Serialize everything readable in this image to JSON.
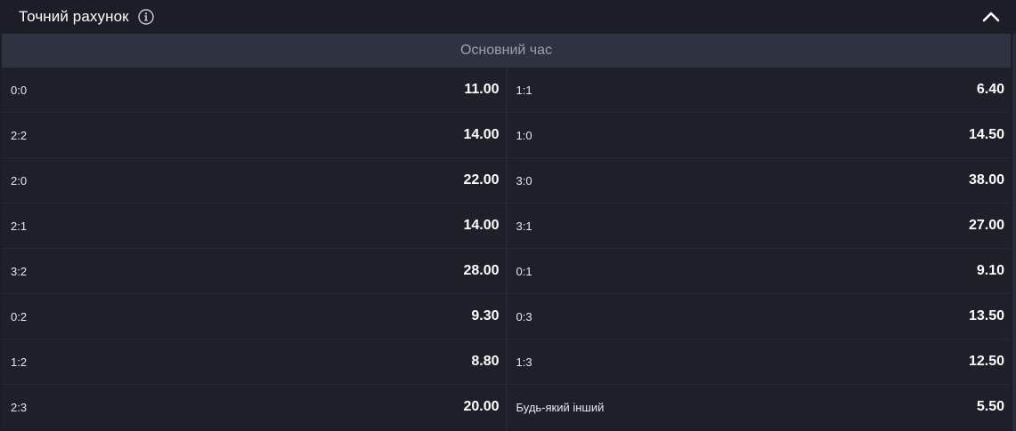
{
  "header": {
    "title": "Точний рахунок",
    "info_icon": "info-icon",
    "collapse_icon": "chevron-up-icon"
  },
  "section": {
    "label": "Основний час"
  },
  "rows": [
    {
      "left": {
        "label": "0:0",
        "odds": "11.00"
      },
      "right": {
        "label": "1:1",
        "odds": "6.40"
      }
    },
    {
      "left": {
        "label": "2:2",
        "odds": "14.00"
      },
      "right": {
        "label": "1:0",
        "odds": "14.50"
      }
    },
    {
      "left": {
        "label": "2:0",
        "odds": "22.00"
      },
      "right": {
        "label": "3:0",
        "odds": "38.00"
      }
    },
    {
      "left": {
        "label": "2:1",
        "odds": "14.00"
      },
      "right": {
        "label": "3:1",
        "odds": "27.00"
      }
    },
    {
      "left": {
        "label": "3:2",
        "odds": "28.00"
      },
      "right": {
        "label": "0:1",
        "odds": "9.10"
      }
    },
    {
      "left": {
        "label": "0:2",
        "odds": "9.30"
      },
      "right": {
        "label": "0:3",
        "odds": "13.50"
      }
    },
    {
      "left": {
        "label": "1:2",
        "odds": "8.80"
      },
      "right": {
        "label": "1:3",
        "odds": "12.50"
      }
    },
    {
      "left": {
        "label": "2:3",
        "odds": "20.00"
      },
      "right": {
        "label": "Будь-який інший",
        "odds": "5.50"
      }
    }
  ],
  "colors": {
    "background": "#1b1d27",
    "section_header": "#2f333f",
    "row_background": "#1e2029",
    "divider": "#262934",
    "text": "#ffffff",
    "muted_text": "#9aa0ad"
  }
}
